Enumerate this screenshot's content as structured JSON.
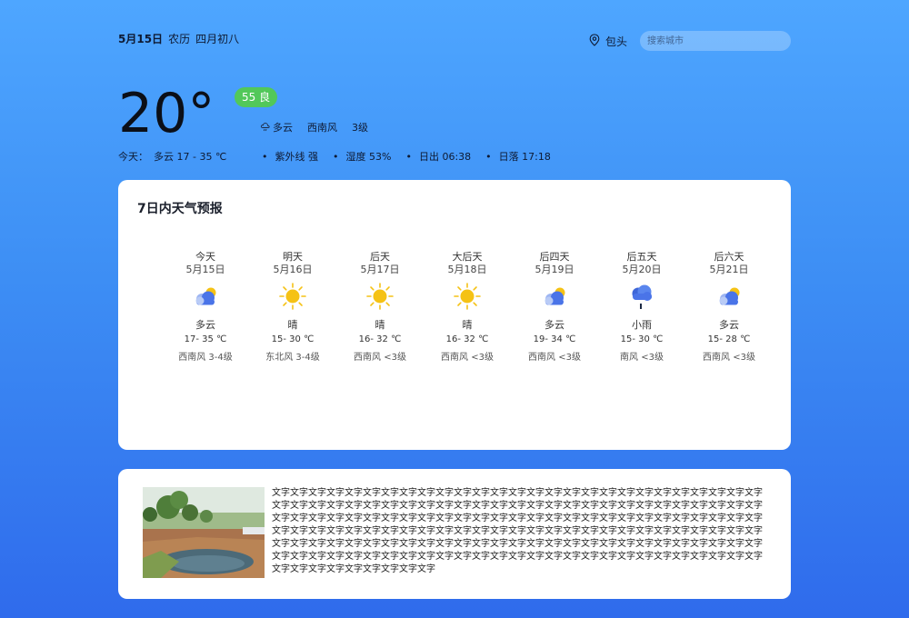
{
  "header": {
    "date": "5月15日",
    "lunar_label": "农历",
    "lunar_date": "四月初八",
    "city": "包头",
    "search_placeholder": "搜索城市"
  },
  "current": {
    "temperature": "20°",
    "aqi": "55 良",
    "condition": "多云",
    "wind_dir": "西南风",
    "wind_level": "3级",
    "today_label": "今天：",
    "today_summary": "多云 17 - 35 ℃",
    "uv": "紫外线 强",
    "humidity": "湿度 53%",
    "sunrise": "日出 06:38",
    "sunset": "日落 17:18"
  },
  "forecast": {
    "title": "7日内天气预报",
    "days": [
      {
        "name": "今天",
        "date": "5月15日",
        "icon": "partly-cloudy-icon",
        "cond": "多云",
        "range": "17- 35 ℃",
        "wind": "西南风 3-4级"
      },
      {
        "name": "明天",
        "date": "5月16日",
        "icon": "sun-icon",
        "cond": "晴",
        "range": "15- 30 ℃",
        "wind": "东北风 3-4级"
      },
      {
        "name": "后天",
        "date": "5月17日",
        "icon": "sun-icon",
        "cond": "晴",
        "range": "16- 32 ℃",
        "wind": "西南风 <3级"
      },
      {
        "name": "大后天",
        "date": "5月18日",
        "icon": "sun-icon",
        "cond": "晴",
        "range": "16- 32 ℃",
        "wind": "西南风 <3级"
      },
      {
        "name": "后四天",
        "date": "5月19日",
        "icon": "partly-cloudy-icon",
        "cond": "多云",
        "range": "19- 34 ℃",
        "wind": "西南风 <3级"
      },
      {
        "name": "后五天",
        "date": "5月20日",
        "icon": "rain-icon",
        "cond": "小雨",
        "range": "15- 30 ℃",
        "wind": "南风 <3级"
      },
      {
        "name": "后六天",
        "date": "5月21日",
        "icon": "partly-cloudy-icon",
        "cond": "多云",
        "range": "15- 28 ℃",
        "wind": "西南风 <3级"
      }
    ]
  },
  "article": {
    "text": "文字文字文字文字文字文字文字文字文字文字文字文字文字文字文字文字文字文字文字文字文字文字文字文字文字文字文字文字文字文字文字文字文字文字文字文字文字文字文字文字文字文字文字文字文字文字文字文字文字文字文字文字文字文字文字文字文字文字文字文字文字文字文字文字文字文字文字文字文字文字文字文字文字文字文字文字文字文字文字文字文字文字文字文字文字文字文字文字文字文字文字文字文字文字文字文字文字文字文字文字文字文字文字文字文字文字文字文字文字文字文字文字文字文字文字文字文字文字文字文字文字文字文字文字文字文字文字文字文字文字文字文字文字文字文字文字文字文字文字文字文字文字文字文字文字文字文字文字文字文字文字文字文字文字文字文字文字文字文字文字文字文字文字文字文字文字文字文字文字文字文字"
  },
  "colors": {
    "aqi_badge": "#52c85a",
    "sun": "#f5c215",
    "cloud": "#4a74e8"
  }
}
